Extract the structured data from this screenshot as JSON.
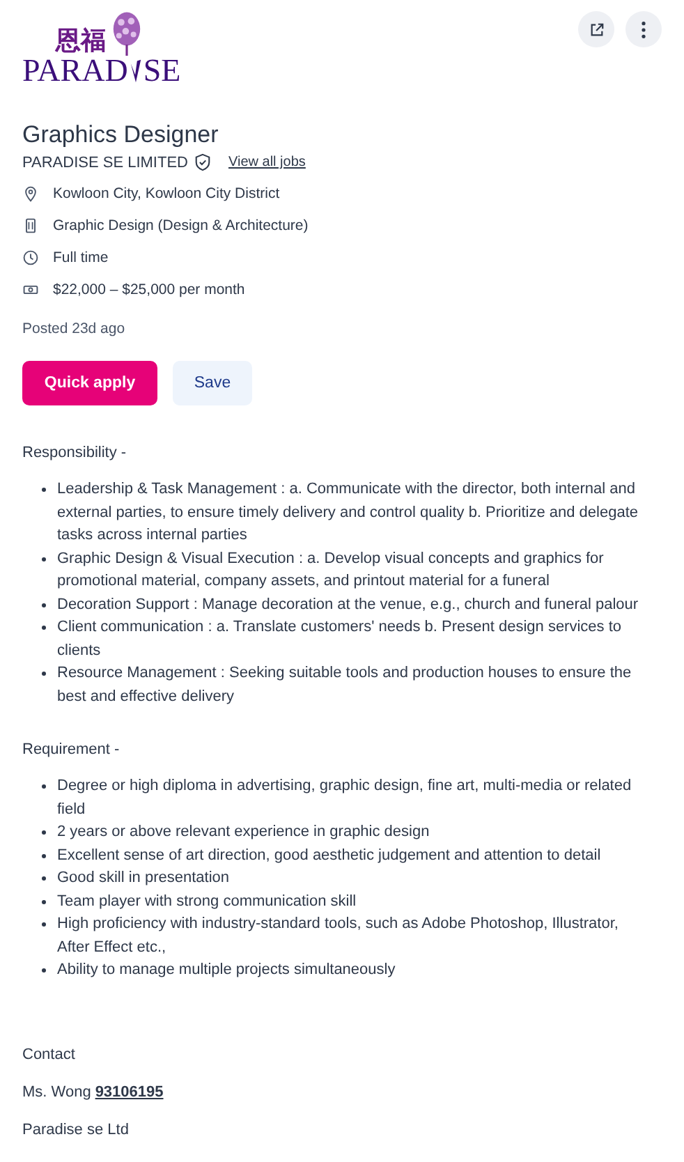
{
  "logo": {
    "chinese": "恩福",
    "word_start": "PARAD",
    "word_end": "SE"
  },
  "actions": [
    {
      "kind": "share"
    },
    {
      "kind": "more"
    }
  ],
  "job": {
    "title": "Graphics Designer",
    "company": "PARADISE SE LIMITED",
    "verified": true,
    "view_all": "View all jobs"
  },
  "details": [
    {
      "kind": "location",
      "text": "Kowloon City, Kowloon City District"
    },
    {
      "kind": "category",
      "text": "Graphic Design (Design & Architecture)"
    },
    {
      "kind": "worktype",
      "text": "Full time"
    },
    {
      "kind": "salary",
      "text": "$22,000 – $25,000 per month"
    }
  ],
  "posted": "Posted 23d ago",
  "buttons": {
    "apply": "Quick apply",
    "save": "Save"
  },
  "sections": [
    {
      "heading": "Responsibility -",
      "items": [
        "Leadership & Task Management : a. Communicate with the director, both internal and external parties, to ensure timely delivery and control quality b. Prioritize and delegate tasks across internal parties",
        "Graphic Design & Visual Execution : a. Develop visual concepts and graphics for promotional material, company assets, and printout material for a funeral",
        "Decoration Support : Manage decoration at the venue, e.g., church and funeral palour",
        "Client communication : a. Translate customers' needs b. Present design services to clients",
        "Resource Management : Seeking suitable tools and production houses to ensure the best and effective delivery"
      ]
    },
    {
      "heading": "Requirement -",
      "items": [
        "Degree or high diploma in advertising, graphic design, fine art, multi-media or related field",
        "2 years or above relevant experience in graphic design",
        "Excellent sense of art direction, good aesthetic judgement and attention to detail",
        "Good skill in presentation",
        "Team player with strong communication skill",
        "High proficiency with industry-standard tools, such as Adobe Photoshop, Illustrator, After Effect etc.,",
        "Ability to manage multiple projects simultaneously"
      ]
    }
  ],
  "contact": {
    "heading": "Contact",
    "name": "Ms. Wong",
    "phone": "93106195",
    "company": "Paradise se Ltd"
  }
}
